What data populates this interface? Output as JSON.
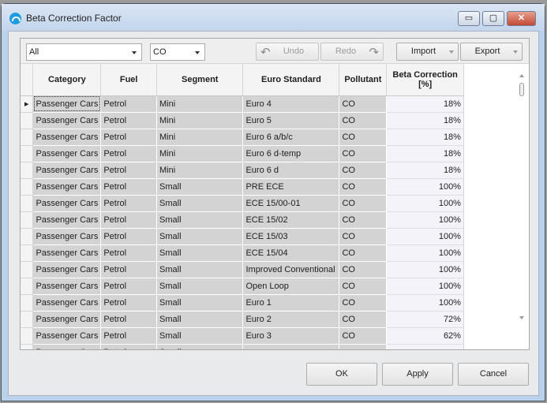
{
  "window": {
    "title": "Beta Correction Factor",
    "minimize": "▭",
    "maximize": "▢",
    "close": "✕"
  },
  "toolbar": {
    "category_filter": "All",
    "pollutant_filter": "CO",
    "undo": "Undo",
    "redo": "Redo",
    "import": "Import",
    "export": "Export"
  },
  "columns": [
    "Category",
    "Fuel",
    "Segment",
    "Euro Standard",
    "Pollutant",
    "Beta Correction [%]"
  ],
  "rows": [
    [
      "Passenger Cars",
      "Petrol",
      "Mini",
      "Euro 4",
      "CO",
      "18%"
    ],
    [
      "Passenger Cars",
      "Petrol",
      "Mini",
      "Euro 5",
      "CO",
      "18%"
    ],
    [
      "Passenger Cars",
      "Petrol",
      "Mini",
      "Euro 6 a/b/c",
      "CO",
      "18%"
    ],
    [
      "Passenger Cars",
      "Petrol",
      "Mini",
      "Euro 6 d-temp",
      "CO",
      "18%"
    ],
    [
      "Passenger Cars",
      "Petrol",
      "Mini",
      "Euro 6 d",
      "CO",
      "18%"
    ],
    [
      "Passenger Cars",
      "Petrol",
      "Small",
      "PRE ECE",
      "CO",
      "100%"
    ],
    [
      "Passenger Cars",
      "Petrol",
      "Small",
      "ECE 15/00-01",
      "CO",
      "100%"
    ],
    [
      "Passenger Cars",
      "Petrol",
      "Small",
      "ECE 15/02",
      "CO",
      "100%"
    ],
    [
      "Passenger Cars",
      "Petrol",
      "Small",
      "ECE 15/03",
      "CO",
      "100%"
    ],
    [
      "Passenger Cars",
      "Petrol",
      "Small",
      "ECE 15/04",
      "CO",
      "100%"
    ],
    [
      "Passenger Cars",
      "Petrol",
      "Small",
      "Improved Conventional",
      "CO",
      "100%"
    ],
    [
      "Passenger Cars",
      "Petrol",
      "Small",
      "Open Loop",
      "CO",
      "100%"
    ],
    [
      "Passenger Cars",
      "Petrol",
      "Small",
      "Euro 1",
      "CO",
      "100%"
    ],
    [
      "Passenger Cars",
      "Petrol",
      "Small",
      "Euro 2",
      "CO",
      "72%"
    ],
    [
      "Passenger Cars",
      "Petrol",
      "Small",
      "Euro 3",
      "CO",
      "62%"
    ],
    [
      "Passenger Cars",
      "Petrol",
      "Small",
      "",
      "",
      ""
    ]
  ],
  "footer": {
    "ok": "OK",
    "apply": "Apply",
    "cancel": "Cancel"
  }
}
